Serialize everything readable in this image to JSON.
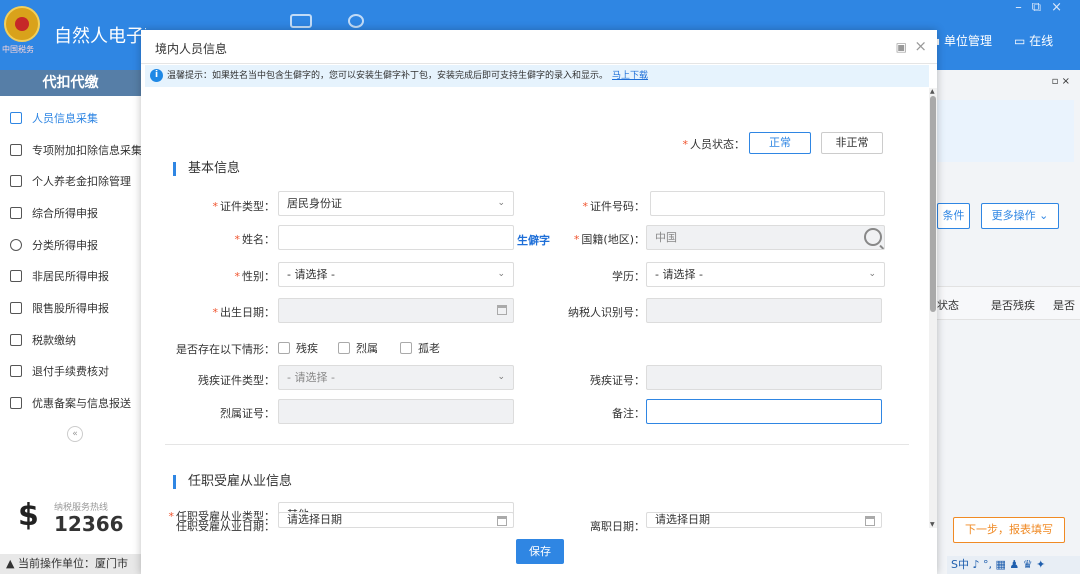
{
  "app": {
    "title": "自然人电子税务局（扣缴端）",
    "emblem_text": "中国税务",
    "unit_mgmt": "单位管理",
    "online": "在线"
  },
  "sidebar": {
    "header": "代扣代缴",
    "items": [
      {
        "label": "人员信息采集",
        "icon": "person-icon",
        "active": true
      },
      {
        "label": "专项附加扣除信息采集",
        "icon": "list-icon"
      },
      {
        "label": "个人养老金扣除管理",
        "icon": "pension-icon"
      },
      {
        "label": "综合所得申报",
        "icon": "layers-icon"
      },
      {
        "label": "分类所得申报",
        "icon": "pie-icon"
      },
      {
        "label": "非居民所得申报",
        "icon": "person-outline-icon"
      },
      {
        "label": "限售股所得申报",
        "icon": "bar-chart-icon"
      },
      {
        "label": "税款缴纳",
        "icon": "wallet-icon"
      },
      {
        "label": "退付手续费核对",
        "icon": "receipt-icon"
      },
      {
        "label": "优惠备案与信息报送",
        "icon": "document-icon"
      }
    ],
    "collapse": "«",
    "hotline_label": "纳税服务热线",
    "hotline_number": "12366",
    "status": "当前操作单位：厦门市"
  },
  "background": {
    "more_conditions": "条件",
    "more_actions": "更多操作",
    "col_status": "状态",
    "col_disabled": "是否残疾",
    "col_more": "是否",
    "next_button": "下一步，报表填写",
    "tray": "S中 ♪ °, ▦ ♟ ♛ ✦"
  },
  "dialog": {
    "title": "境内人员信息",
    "notice": "温馨提示：如果姓名当中包含生僻字的，您可以安装生僻字补丁包，安装完成后即可支持生僻字的录入和显示。",
    "notice_link": "马上下载",
    "person_status_label": "人员状态：",
    "status_normal": "正常",
    "status_abnormal": "非正常",
    "section_basic": "基本信息",
    "section_employment": "任职受雇从业信息",
    "save": "保存",
    "fields": {
      "id_type": {
        "label": "证件类型：",
        "value": "居民身份证"
      },
      "id_number": {
        "label": "证件号码：",
        "value": ""
      },
      "name": {
        "label": "姓名：",
        "value": ""
      },
      "rare_char": "生僻字",
      "nationality": {
        "label": "国籍(地区)：",
        "value": "中国"
      },
      "gender": {
        "label": "性别：",
        "value": "- 请选择 -"
      },
      "education": {
        "label": "学历：",
        "value": "- 请选择 -"
      },
      "birth_date": {
        "label": "出生日期：",
        "value": ""
      },
      "taxpayer_id": {
        "label": "纳税人识别号：",
        "value": ""
      },
      "conditions": {
        "label": "是否存在以下情形：",
        "options": [
          "残疾",
          "烈属",
          "孤老"
        ]
      },
      "disability_cert_type": {
        "label": "残疾证件类型：",
        "value": "- 请选择 -"
      },
      "disability_cert_no": {
        "label": "残疾证号：",
        "value": ""
      },
      "martyr_cert_no": {
        "label": "烈属证号：",
        "value": ""
      },
      "remarks": {
        "label": "备注：",
        "value": ""
      },
      "employment_type": {
        "label": "任职受雇从业类型：",
        "value": "其他"
      },
      "employment_date": {
        "label": "任职受雇从业日期：",
        "value": "请选择日期"
      },
      "leave_date": {
        "label": "离职日期：",
        "value": "请选择日期"
      }
    }
  }
}
